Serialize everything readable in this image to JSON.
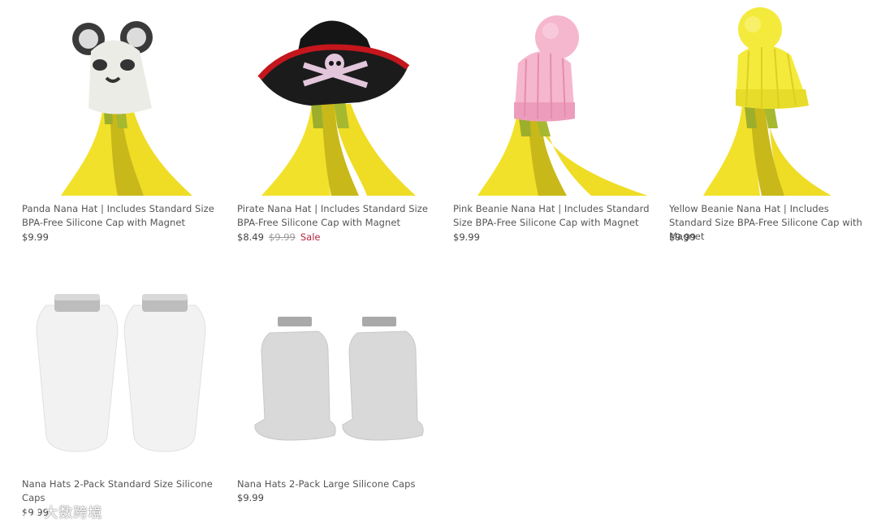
{
  "products": [
    {
      "title": "Panda Nana Hat | Includes Standard Size BPA-Free Silicone Cap with Magnet",
      "price": "$9.99",
      "hat_color": "#ecece6",
      "pom_color": "#3a3a3a"
    },
    {
      "title": "Pirate Nana Hat | Includes Standard Size BPA-Free Silicone Cap with Magnet",
      "price": "$8.49",
      "compare_price": "$9.99",
      "badge": "Sale",
      "hat_color": "#151515",
      "brim_color": "#c4161c"
    },
    {
      "title": "Pink Beanie Nana Hat | Includes Standard Size BPA-Free Silicone Cap with Magnet",
      "price": "$9.99",
      "hat_color": "#f5b7cd"
    },
    {
      "title": "Yellow Beanie Nana Hat | Includes Standard Size BPA-Free Silicone Cap with Magnet",
      "price": "$9.99",
      "hat_color": "#f4ea3c"
    },
    {
      "title": "Nana Hats 2-Pack Standard Size Silicone Caps",
      "price": "$9.99",
      "cap_color": "#f2f2f2"
    },
    {
      "title": "Nana Hats 2-Pack Large Silicone Caps",
      "price": "$9.99",
      "cap_color": "#d9d9d9"
    }
  ],
  "colors": {
    "banana": "#f2e12a",
    "banana_shadow": "#c9b81a",
    "stem": "#9cae2c",
    "sale": "#b3263e"
  },
  "watermark": {
    "text": "大数跨境"
  }
}
